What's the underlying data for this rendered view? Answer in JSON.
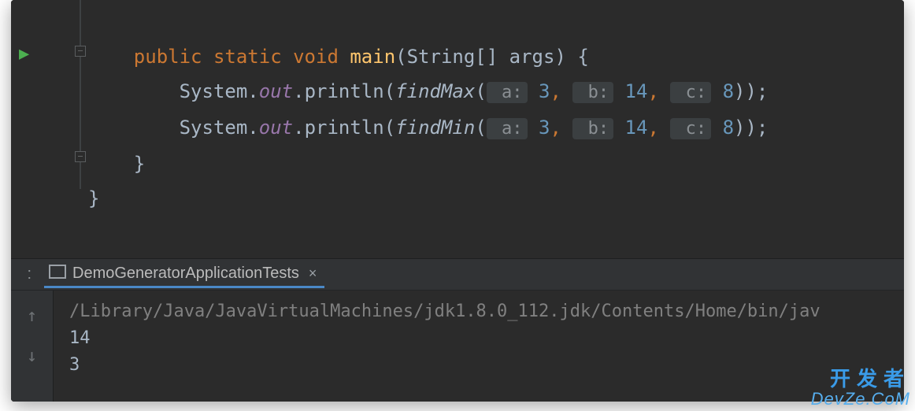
{
  "code": {
    "kw_public": "public",
    "kw_static": "static",
    "kw_void": "void",
    "fn_main": "main",
    "sig_open": "(",
    "sig_type": "String[] args",
    "sig_close": ") {",
    "lines": [
      {
        "indent": "        ",
        "recv": "System",
        "dot1": ".",
        "field": "out",
        "dot2": ".",
        "method": "println",
        "open": "(",
        "call": "findMax",
        "open2": "(",
        "hint_a": " a:",
        "val_a": "3",
        "comma1": ",",
        "hint_b": " b:",
        "val_b": "14",
        "comma2": ",",
        "hint_c": " c:",
        "val_c": "8",
        "close": "));"
      },
      {
        "indent": "        ",
        "recv": "System",
        "dot1": ".",
        "field": "out",
        "dot2": ".",
        "method": "println",
        "open": "(",
        "call": "findMin",
        "open2": "(",
        "hint_a": " a:",
        "val_a": "3",
        "comma1": ",",
        "hint_b": " b:",
        "val_b": "14",
        "comma2": ",",
        "hint_c": " c:",
        "val_c": "8",
        "close": "));"
      }
    ],
    "close_method": "    }",
    "close_class": "}"
  },
  "console": {
    "tab_prefix": ":",
    "tab_label": "DemoGeneratorApplicationTests",
    "cmd": "/Library/Java/JavaVirtualMachines/jdk1.8.0_112.jdk/Contents/Home/bin/jav",
    "out1": "14",
    "out2": "3"
  },
  "watermark": {
    "cn": "开发者",
    "en": "DevZe.CoM"
  }
}
